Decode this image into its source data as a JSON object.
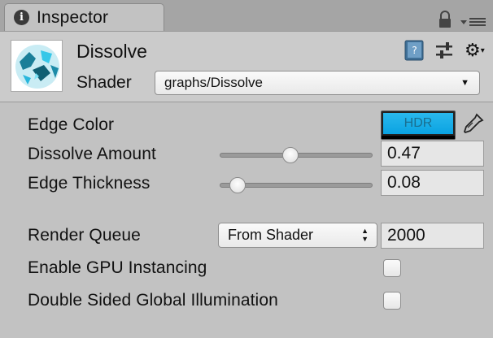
{
  "tab": {
    "label": "Inspector",
    "icon": "info-icon"
  },
  "header": {
    "title": "Dissolve",
    "shader_label": "Shader",
    "shader_value": "graphs/Dissolve",
    "icons": [
      "material-preview-icon",
      "book-help-icon",
      "sliders-icon",
      "gear-icon",
      "lock-icon",
      "menu-icon"
    ]
  },
  "properties": {
    "edge_color": {
      "label": "Edge Color",
      "hdr_text": "HDR",
      "color": "#17b4ea"
    },
    "dissolve_amount": {
      "label": "Dissolve Amount",
      "value": "0.47",
      "slider_fraction": 0.47
    },
    "edge_thickness": {
      "label": "Edge Thickness",
      "value": "0.08",
      "slider_fraction": 0.08
    },
    "render_queue": {
      "label": "Render Queue",
      "dropdown_value": "From Shader",
      "value": "2000"
    },
    "gpu_instancing": {
      "label": "Enable GPU Instancing",
      "checked": false
    },
    "double_sided_gi": {
      "label": "Double Sided Global Illumination",
      "checked": false
    }
  },
  "colors": {
    "panel_bg": "#c2c2c2",
    "header_bg": "#cbcbcb",
    "tabbar_bg": "#a5a5a5",
    "hdr_swatch": "#17b4ea"
  }
}
